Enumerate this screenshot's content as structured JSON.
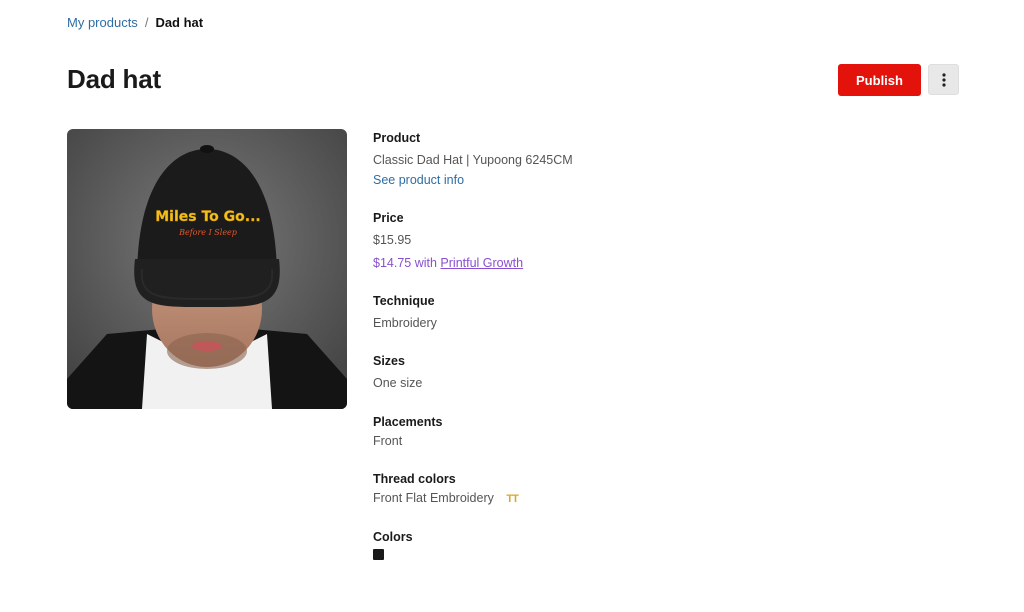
{
  "breadcrumb": {
    "parent": "My products",
    "separator": "/",
    "current": "Dad hat"
  },
  "page_title": "Dad hat",
  "actions": {
    "publish_label": "Publish",
    "more_icon": "vertical-ellipsis-icon"
  },
  "product_image": {
    "hat_text_main": "Miles To Go...",
    "hat_text_sub": "Before I Sleep",
    "hat_color": "#1b1b1b",
    "text_color_main": "#f2c21b",
    "text_color_sub": "#e8562a"
  },
  "details": {
    "product": {
      "label": "Product",
      "value": "Classic Dad Hat | Yupoong 6245CM",
      "link": "See product info"
    },
    "price": {
      "label": "Price",
      "value": "$15.95",
      "growth_prefix": "$14.75 with",
      "growth_link": "Printful Growth"
    },
    "technique": {
      "label": "Technique",
      "value": "Embroidery"
    },
    "sizes": {
      "label": "Sizes",
      "value": "One size"
    },
    "placements": {
      "label": "Placements",
      "value": "Front"
    },
    "thread_colors": {
      "label": "Thread colors",
      "value": "Front Flat Embroidery",
      "icon": "TT",
      "icon_color": "#d7a92a"
    },
    "colors": {
      "label": "Colors",
      "swatch_color": "#1a1a1a"
    }
  }
}
